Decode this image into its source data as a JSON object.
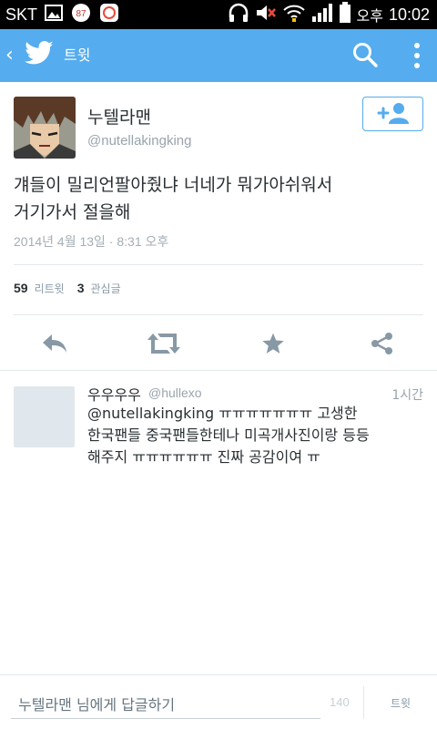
{
  "status_bar": {
    "carrier": "SKT",
    "badge_count": "87",
    "ampm": "오후",
    "time": "10:02"
  },
  "action_bar": {
    "title": "트윗"
  },
  "tweet": {
    "author_name": "누텔라맨",
    "author_handle": "@nutellakingking",
    "text_line1": "걔들이 밀리언팔아줬냐 너네가 뭐가아쉬워서",
    "text_line2": "거기가서 절을해",
    "date": "2014년 4월 13일 · 8:31 오후",
    "retweet_count": "59",
    "retweet_label": "리트윗",
    "favorite_count": "3",
    "favorite_label": "관심글"
  },
  "reply": {
    "name": "우우우우",
    "handle": "@hullexo",
    "time": "1시간",
    "text_line1": "@nutellakingking  ㅠㅠㅠㅠㅠㅠㅠ 고생한",
    "text_line2": "한국팬들 중국팬들한테나 미곡개사진이랑 등등",
    "text_line3": "해주지 ㅠㅠㅠㅠㅠㅠ 진짜 공감이여 ㅠ"
  },
  "compose": {
    "placeholder": "누텔라맨 님에게 답글하기",
    "char_count": "140",
    "button_label": "트윗"
  },
  "colors": {
    "brand": "#55acee",
    "text": "#292f33",
    "muted": "#99a4ad",
    "icon": "#8899a6"
  }
}
